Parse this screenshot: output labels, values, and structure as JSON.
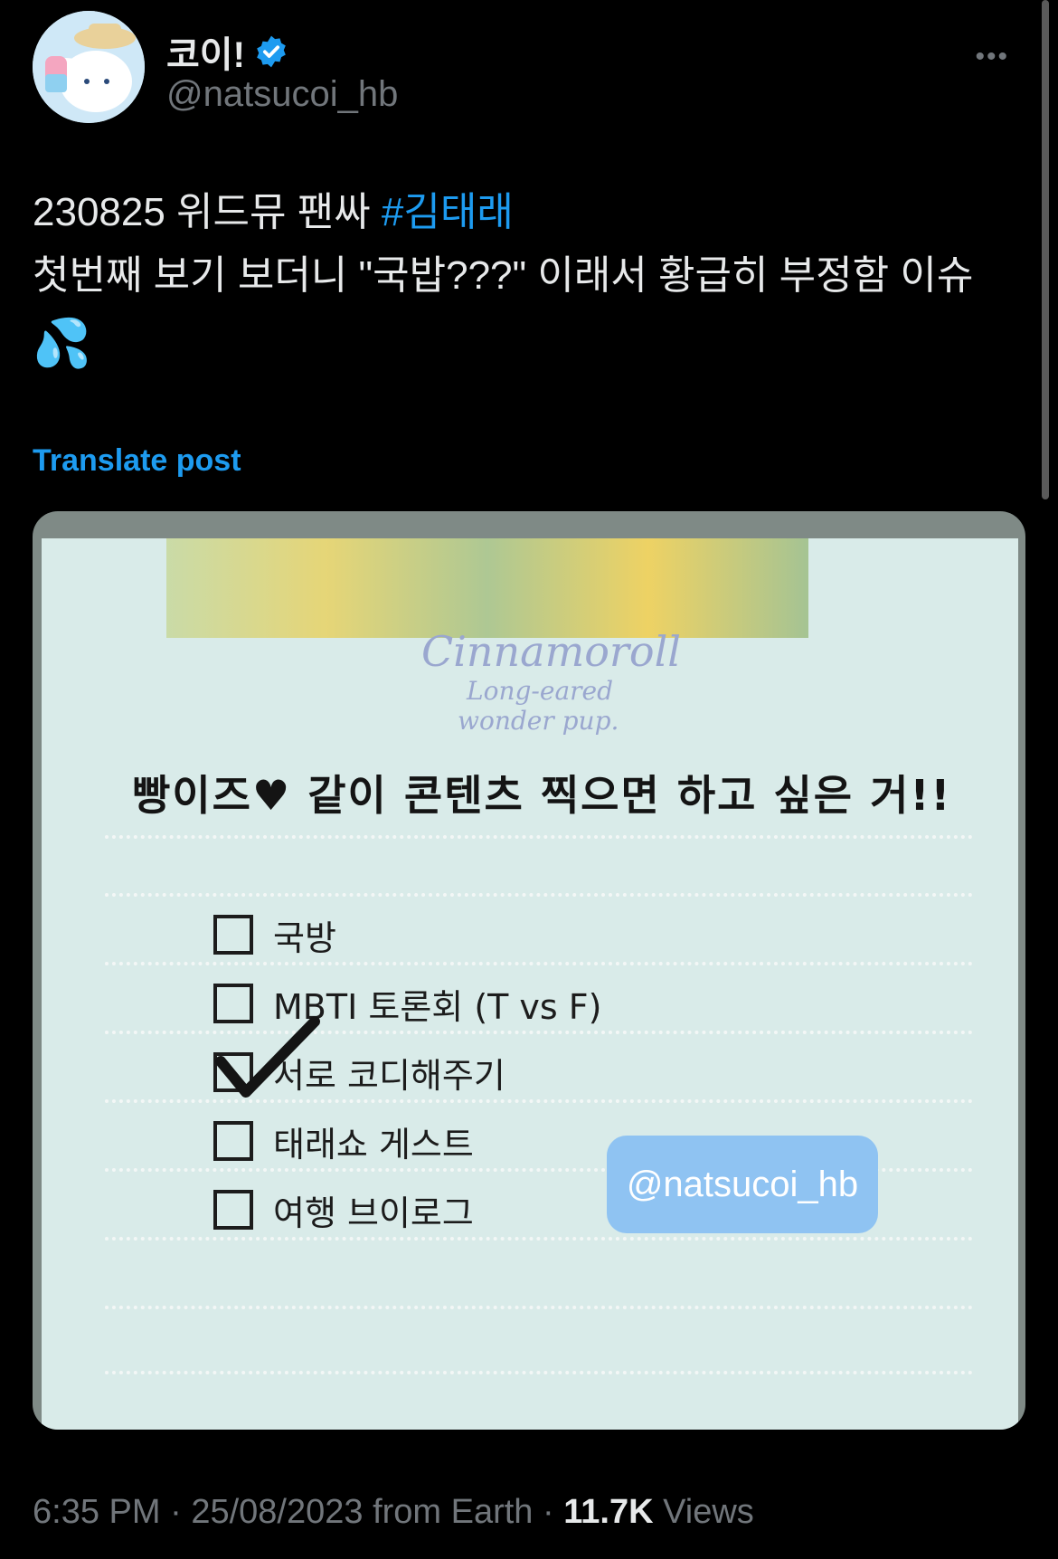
{
  "author": {
    "display_name": "코이!",
    "handle": "@natsucoi_hb",
    "verified": true
  },
  "tweet": {
    "text_line1": "230825 위드뮤 팬싸 ",
    "hashtag": "#김태래",
    "text_line2": "첫번째 보기 보더니 \"국밥???\" 이래서 황급히 부정함 이슈",
    "emoji": "💦"
  },
  "translate_label": "Translate post",
  "media": {
    "brand_title": "Cinnamoroll",
    "brand_sub1": "Long-eared",
    "brand_sub2": "wonder pup.",
    "heading": "빵이즈♥ 같이 콘텐츠 찍으면 하고 싶은 거!!",
    "items": [
      {
        "label": "국방",
        "checked": false
      },
      {
        "label": "MBTI 토론회 (T vs F)",
        "checked": false
      },
      {
        "label": "서로 코디해주기",
        "checked": true
      },
      {
        "label": "태래쇼 게스트",
        "checked": false
      },
      {
        "label": "여행 브이로그",
        "checked": false
      }
    ],
    "watermark": "@natsucoi_hb"
  },
  "meta": {
    "time": "6:35 PM",
    "date": "25/08/2023",
    "source": "from Earth",
    "views_count": "11.7K",
    "views_label": "Views"
  },
  "colors": {
    "accent": "#1d9bf0",
    "muted": "#71767b",
    "background": "#000000"
  }
}
